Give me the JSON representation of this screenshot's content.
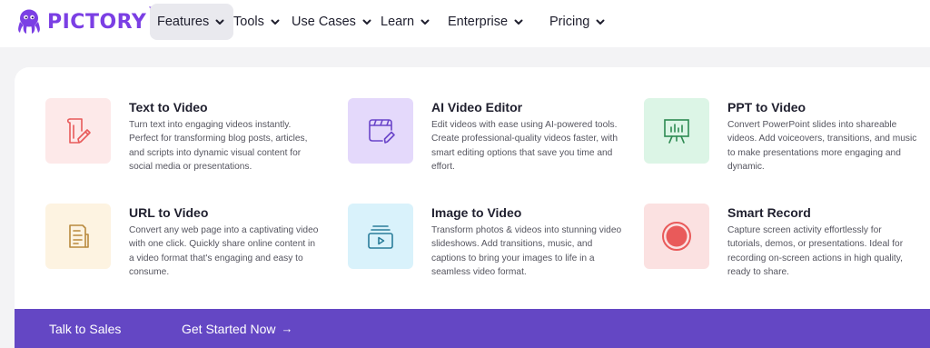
{
  "brand": {
    "name": "PICTORY",
    "tm": "TM",
    "color": "#7b3fe4"
  },
  "nav": {
    "items": [
      {
        "label": "Features",
        "active": true
      },
      {
        "label": "Tools"
      },
      {
        "label": "Use Cases"
      },
      {
        "label": "Learn"
      },
      {
        "label": "Enterprise"
      },
      {
        "label": "Pricing"
      }
    ],
    "chevron_icon": "chevron-down-icon"
  },
  "features": [
    {
      "title": "Text to Video",
      "description": "Turn text into engaging videos instantly. Perfect for transforming blog posts, articles, and scripts into dynamic visual content for social media or presentations.",
      "icon": "document-pen-icon",
      "icon_bg": "#fde9e9",
      "icon_color": "#e85a5a"
    },
    {
      "title": "AI Video Editor",
      "description": "Edit videos with ease using AI-powered tools. Create professional-quality videos faster, with smart editing options that save you time and effort.",
      "icon": "video-edit-icon",
      "icon_bg": "#e4d9fb",
      "icon_color": "#6a45c9"
    },
    {
      "title": "PPT to Video",
      "description": "Convert PowerPoint slides into shareable videos. Add voiceovers, transitions, and music to make presentations more engaging and dynamic.",
      "icon": "presentation-board-icon",
      "icon_bg": "#dcf5e6",
      "icon_color": "#2e8a52"
    },
    {
      "title": "URL to Video",
      "description": "Convert any web page into a captivating video with one click. Quickly share online content in a video format that's engaging and easy to consume.",
      "icon": "web-page-icon",
      "icon_bg": "#fdf3e1",
      "icon_color": "#b98a3e"
    },
    {
      "title": "Image to Video",
      "description": "Transform photos & videos into stunning video slideshows. Add transitions, music, and captions to bring your images to life in a seamless video format.",
      "icon": "image-stack-play-icon",
      "icon_bg": "#d9f2fb",
      "icon_color": "#2a7d9a"
    },
    {
      "title": "Smart Record",
      "description": "Capture screen activity effortlessly for tutorials, demos, or presentations. Ideal for recording on-screen actions in high quality, ready to share.",
      "icon": "record-icon",
      "icon_bg": "#fbe1e1",
      "icon_color": "#e95a5a"
    }
  ],
  "footer_bar": {
    "talk_to_sales": "Talk to Sales",
    "get_started": "Get Started Now",
    "arrow": "→",
    "bg": "#6447c4"
  }
}
